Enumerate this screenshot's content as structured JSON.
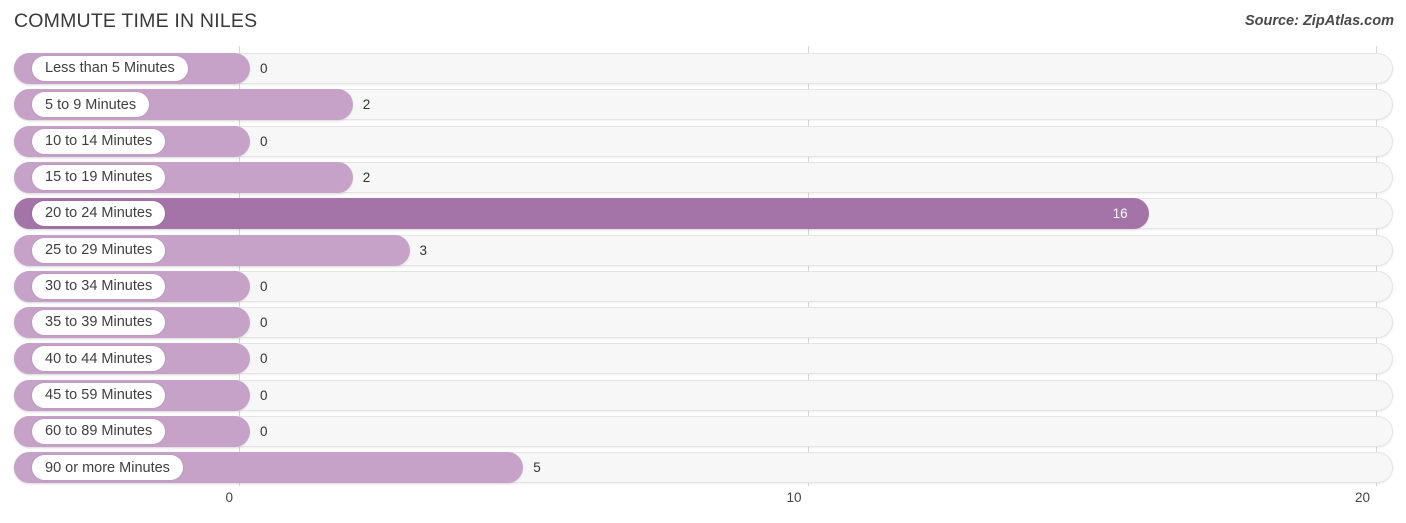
{
  "header": {
    "title": "COMMUTE TIME IN NILES",
    "source": "Source: ZipAtlas.com"
  },
  "colors": {
    "bar": "#c6a2c8",
    "bar_highlight": "#a473a8",
    "track": "#f7f7f7",
    "gridline": "#d6d6d6"
  },
  "chart_data": {
    "type": "bar",
    "orientation": "horizontal",
    "title": "COMMUTE TIME IN NILES",
    "xlabel": "",
    "ylabel": "",
    "xlim": [
      0,
      20
    ],
    "xticks": [
      "0",
      "10",
      "20"
    ],
    "xtick_values": [
      0,
      10,
      20
    ],
    "grid": true,
    "legend": false,
    "highlight_category": "20 to 24 Minutes",
    "categories": [
      "Less than 5 Minutes",
      "5 to 9 Minutes",
      "10 to 14 Minutes",
      "15 to 19 Minutes",
      "20 to 24 Minutes",
      "25 to 29 Minutes",
      "30 to 34 Minutes",
      "35 to 39 Minutes",
      "40 to 44 Minutes",
      "45 to 59 Minutes",
      "60 to 89 Minutes",
      "90 or more Minutes"
    ],
    "values": [
      0,
      2,
      0,
      2,
      16,
      3,
      0,
      0,
      0,
      0,
      0,
      5
    ],
    "value_labels": [
      "0",
      "2",
      "0",
      "2",
      "16",
      "3",
      "0",
      "0",
      "0",
      "0",
      "0",
      "5"
    ]
  }
}
